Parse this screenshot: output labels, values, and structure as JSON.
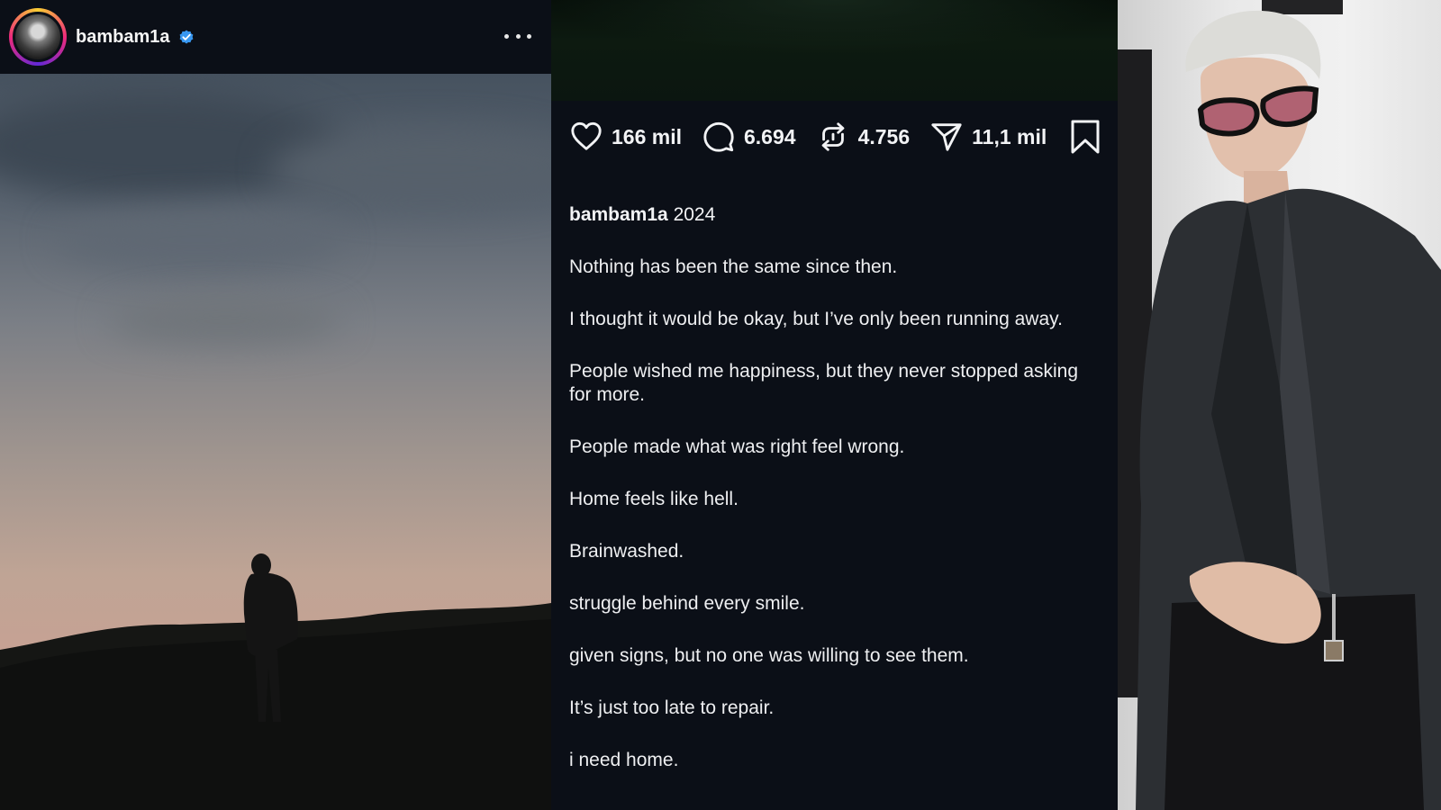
{
  "post": {
    "username": "bambam1a",
    "verified": true
  },
  "actions": {
    "likes": "166 mil",
    "comments": "6.694",
    "reposts": "4.756",
    "shares": "11,1 mil"
  },
  "caption": {
    "author": "bambam1a",
    "year": "2024",
    "lines": [
      "Nothing has been the same since then.",
      "I thought it would be okay, but I’ve only been running away.",
      "People wished me happiness, but they never stopped asking for more.",
      "People made what was right feel wrong.",
      "Home feels like hell.",
      "Brainwashed.",
      "struggle behind every smile.",
      "given signs, but no one was willing to see them.",
      "It’s just too late to repair.",
      "i need home."
    ]
  },
  "icons": {
    "verified": "verified-badge-icon",
    "more": "more-options-icon",
    "like": "heart-icon",
    "comment": "comment-bubble-icon",
    "repost": "repost-arrows-icon",
    "share": "send-paper-plane-icon",
    "save": "bookmark-icon"
  },
  "colors": {
    "background": "#0b0f17",
    "text": "#f2f3f5",
    "verified": "#3897f0"
  }
}
